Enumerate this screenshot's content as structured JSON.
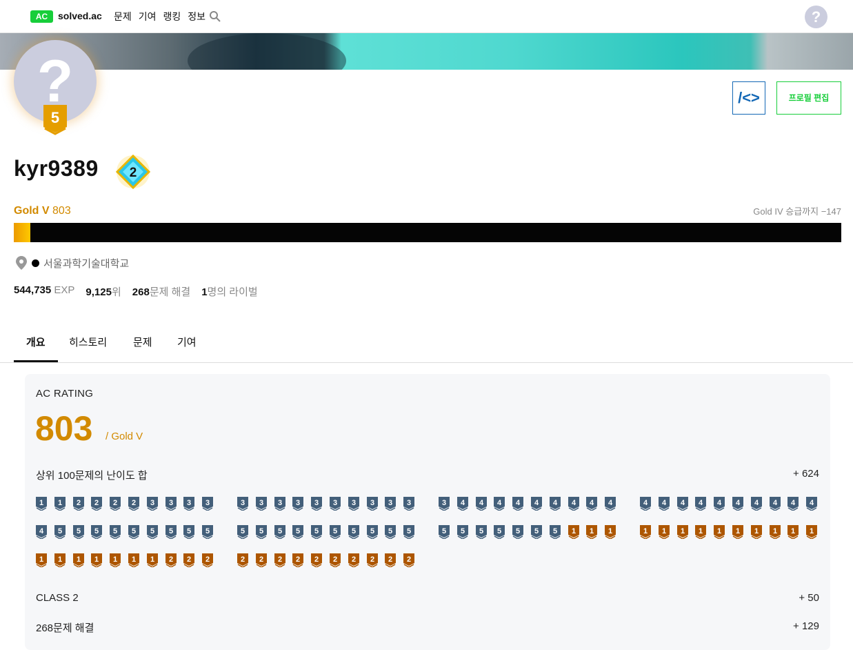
{
  "nav": {
    "logo": "AC",
    "site_name": "solved.ac",
    "links": [
      "문제",
      "기여",
      "랭킹",
      "정보"
    ],
    "help_icon_text": "?"
  },
  "profile": {
    "avatar_glyph": "?",
    "tier_level": "5",
    "class_level": "2",
    "username": "kyr9389",
    "code_button": "/<>",
    "edit_button": "프로필 편집",
    "tier_name": "Gold V",
    "rating": "803",
    "promotion": "Gold IV 승급까지 −147",
    "progress_fraction": 0.02,
    "school": "서울과학기술대학교",
    "stats": {
      "exp_value": "544,735",
      "exp_label": "EXP",
      "rank_value": "9,125",
      "rank_label": "위",
      "solved_value": "268",
      "solved_label": "문제 해결",
      "rival_value": "1",
      "rival_label": "명의 라이벌"
    }
  },
  "tabs": [
    "개요",
    "히스토리",
    "문제",
    "기여"
  ],
  "overview": {
    "section_title": "AC RATING",
    "rating": "803",
    "rating_tier": "/ Gold V",
    "top100_label": "상위 100문제의 난이도 합",
    "top100_value": "+ 624",
    "class_label": "CLASS 2",
    "class_value": "+ 50",
    "solved_label": "268문제 해결",
    "solved_value": "+ 129",
    "problem_tiers": [
      "g1",
      "g1",
      "g2",
      "g2",
      "g2",
      "g2",
      "g3",
      "g3",
      "g3",
      "g3",
      "g3",
      "g3",
      "g3",
      "g3",
      "g3",
      "g3",
      "g3",
      "g3",
      "g3",
      "g3",
      "g3",
      "g4",
      "g4",
      "g4",
      "g4",
      "g4",
      "g4",
      "g4",
      "g4",
      "g4",
      "g4",
      "g4",
      "g4",
      "g4",
      "g4",
      "g4",
      "g4",
      "g4",
      "g4",
      "g4",
      "g4",
      "g5",
      "g5",
      "g5",
      "g5",
      "g5",
      "g5",
      "g5",
      "g5",
      "g5",
      "g5",
      "g5",
      "g5",
      "g5",
      "g5",
      "g5",
      "g5",
      "g5",
      "g5",
      "g5",
      "g5",
      "g5",
      "g5",
      "g5",
      "g5",
      "g5",
      "g5",
      "b1",
      "b1",
      "b1",
      "b1",
      "b1",
      "b1",
      "b1",
      "b1",
      "b1",
      "b1",
      "b1",
      "b1",
      "b1",
      "b1",
      "b1",
      "b1",
      "b1",
      "b1",
      "b1",
      "b1",
      "b2",
      "b2",
      "b2",
      "b2",
      "b2",
      "b2",
      "b2",
      "b2",
      "b2",
      "b2",
      "b2",
      "b2",
      "b2"
    ]
  },
  "colors": {
    "gold_text": "#d28a00",
    "silver_badge": "#435f7a",
    "bronze_badge": "#ad5600",
    "ac_green": "#17ce3a",
    "code_blue": "#1267b5"
  }
}
